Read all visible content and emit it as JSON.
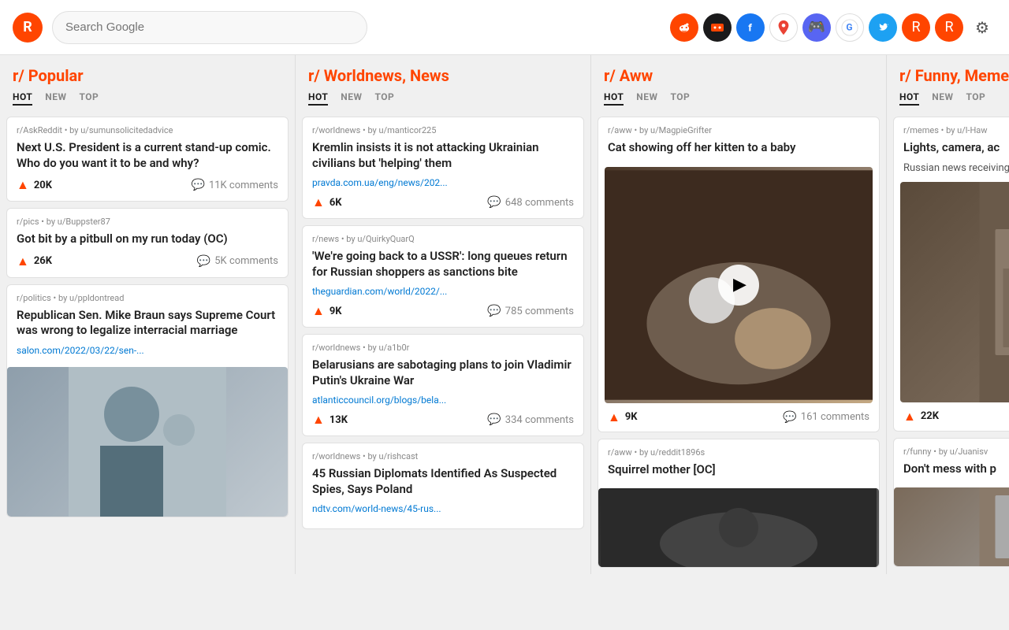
{
  "header": {
    "logo_letter": "R",
    "search_placeholder": "Search Google",
    "icons": [
      {
        "name": "reddit-snoo",
        "label": "r/",
        "type": "reddit-icon",
        "symbol": "👽"
      },
      {
        "name": "alien-dark",
        "label": "dark reddit",
        "type": "dark-icon",
        "symbol": "👾"
      },
      {
        "name": "facebook",
        "label": "Facebook",
        "type": "facebook-icon",
        "symbol": "f"
      },
      {
        "name": "google-maps",
        "label": "Google Maps",
        "type": "google-maps-icon",
        "symbol": "📍"
      },
      {
        "name": "discord",
        "label": "Discord",
        "type": "discord-icon",
        "symbol": "💬"
      },
      {
        "name": "google",
        "label": "Google",
        "type": "google-icon",
        "symbol": "G"
      },
      {
        "name": "twitter",
        "label": "Twitter",
        "type": "twitter-icon",
        "symbol": "🐦"
      },
      {
        "name": "reddit-red1",
        "label": "Reddit",
        "type": "reddit2-icon",
        "symbol": "R"
      },
      {
        "name": "reddit-red2",
        "label": "Reddit 2",
        "type": "reddit3-icon",
        "symbol": "R"
      },
      {
        "name": "settings",
        "label": "Settings",
        "type": "settings-icon",
        "symbol": "⚙"
      }
    ]
  },
  "columns": [
    {
      "id": "popular",
      "title_prefix": "r/",
      "title_main": "Popular",
      "tabs": [
        "HOT",
        "NEW",
        "TOP"
      ],
      "active_tab": "HOT",
      "posts": [
        {
          "subreddit": "r/AskReddit",
          "author": "u/sumunsolicitedadvice",
          "title": "Next U.S. President is a current stand-up comic. Who do you want it to be and why?",
          "link": null,
          "votes": "20K",
          "comments": "11K comments",
          "has_image": false
        },
        {
          "subreddit": "r/pics",
          "author": "u/Buppster87",
          "title": "Got bit by a pitbull on my run today (OC)",
          "link": null,
          "votes": "26K",
          "comments": "5K comments",
          "has_image": false
        },
        {
          "subreddit": "r/politics",
          "author": "u/ppldontread",
          "title": "Republican Sen. Mike Braun says Supreme Court was wrong to legalize interracial marriage",
          "link": "salon.com/2022/03/22/sen-...",
          "votes": null,
          "comments": null,
          "has_image": true,
          "image_type": "senator"
        }
      ]
    },
    {
      "id": "worldnews",
      "title_prefix": "r/",
      "title_main": "Worldnews, News",
      "tabs": [
        "HOT",
        "NEW",
        "TOP"
      ],
      "active_tab": "HOT",
      "posts": [
        {
          "subreddit": "r/worldnews",
          "author": "u/manticor225",
          "title": "Kremlin insists it is not attacking Ukrainian civilians but 'helping' them",
          "link": "pravda.com.ua/eng/news/202...",
          "votes": "6K",
          "comments": "648 comments",
          "has_image": false
        },
        {
          "subreddit": "r/news",
          "author": "u/QuirkyQuarQ",
          "title": "'We're going back to a USSR': long queues return for Russian shoppers as sanctions bite",
          "link": "theguardian.com/world/2022/...",
          "votes": "9K",
          "comments": "785 comments",
          "has_image": false
        },
        {
          "subreddit": "r/worldnews",
          "author": "u/a1b0r",
          "title": "Belarusians are sabotaging plans to join Vladimir Putin's Ukraine War",
          "link": "atlanticcouncil.org/blogs/bela...",
          "votes": "13K",
          "comments": "334 comments",
          "has_image": false
        },
        {
          "subreddit": "r/worldnews",
          "author": "u/rishcast",
          "title": "45 Russian Diplomats Identified As Suspected Spies, Says Poland",
          "link": "ndtv.com/world-news/45-rus...",
          "votes": null,
          "comments": null,
          "has_image": false
        }
      ]
    },
    {
      "id": "aww",
      "title_prefix": "r/",
      "title_main": "Aww",
      "tabs": [
        "HOT",
        "NEW",
        "TOP"
      ],
      "active_tab": "HOT",
      "posts": [
        {
          "subreddit": "r/aww",
          "author": "u/MagpieGrifter",
          "title": "Cat showing off her kitten to a baby",
          "votes": "9K",
          "comments": "161 comments",
          "has_image": true,
          "image_type": "aww-video"
        },
        {
          "subreddit": "r/aww",
          "author": "u/reddit1896s",
          "title": "Squirrel mother [OC]",
          "votes": null,
          "comments": null,
          "has_image": true,
          "image_type": "squirrel"
        }
      ]
    },
    {
      "id": "funny",
      "title_prefix": "r/",
      "title_main": "Funny, Memes,",
      "tabs": [
        "HOT",
        "NEW",
        "TOP"
      ],
      "active_tab": "HOT",
      "posts": [
        {
          "subreddit": "r/memes",
          "author": "u/l-Haw",
          "title": "Lights, camera, ac",
          "extra": "Russian news receiving toda",
          "votes": "22K",
          "comments": null,
          "has_image": true,
          "image_type": "funny-video"
        },
        {
          "subreddit": "r/funny",
          "author": "u/Juanisv",
          "title": "Don't mess with p",
          "votes": null,
          "comments": null,
          "has_image": true,
          "image_type": "funny2"
        }
      ]
    }
  ]
}
